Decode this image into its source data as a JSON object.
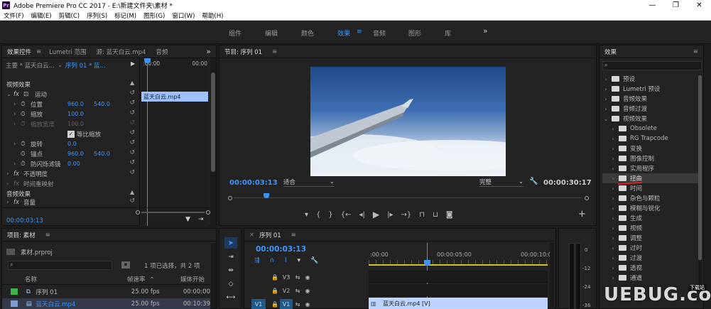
{
  "window": {
    "title": "Adobe Premiere Pro CC 2017 - E:\\新建文件夹\\素材 *",
    "logo": "Pr",
    "controls": [
      "—",
      "❐",
      "✕"
    ]
  },
  "menu": [
    "文件(F)",
    "编辑(E)",
    "剪辑(C)",
    "序列(S)",
    "标记(M)",
    "图形(G)",
    "窗口(W)",
    "帮助(H)"
  ],
  "workspaces": {
    "items": [
      "组件",
      "编辑",
      "颜色",
      "效果",
      "音频",
      "图形",
      "库"
    ],
    "active": "效果",
    "menu_icon": "≡",
    "more": "»"
  },
  "effect_controls": {
    "tabs": [
      "效果控件",
      "Lumetri 范围",
      "源: 蓝天白云.mp4",
      "音频"
    ],
    "tab_menu": "≡",
    "more": "»",
    "master_label": "主要 * 蓝天白云...",
    "sequence_label": "序列 01 * 蓝...",
    "time_start": ":00:00",
    "time_end": "00:00",
    "clip_label": "蓝天白云.mp4",
    "video_effects_label": "视频效果",
    "motion": {
      "fx": "fx",
      "label": "运动",
      "position_label": "位置",
      "position_x": "960.0",
      "position_y": "540.0",
      "scale_label": "缩放",
      "scale_value": "100.0",
      "scale_width_label": "缩放宽度",
      "scale_width_value": "100.0",
      "uniform_label": "等比缩放",
      "rotation_label": "旋转",
      "rotation_value": "0.0",
      "anchor_label": "锚点",
      "anchor_x": "960.0",
      "anchor_y": "540.0",
      "flicker_label": "防闪烁滤镜",
      "flicker_value": "0.00"
    },
    "opacity_label": "不透明度",
    "time_remap_label": "时间重映射",
    "audio_effects_label": "音频效果",
    "volume_label": "音量",
    "current_time": "00:00:03:13"
  },
  "program_monitor": {
    "title": "节目: 序列 01",
    "menu": "≡",
    "timecode": "00:00:03:13",
    "fit_label": "适合",
    "quality_label": "完整",
    "duration": "00:00:30:17"
  },
  "project": {
    "title": "项目: 素材",
    "menu": "≡",
    "file_label": "素材.prproj",
    "selection_info": "1 项已选择，共 2 项",
    "columns": [
      "名称",
      "帧速率",
      "媒体开始"
    ],
    "rows": [
      {
        "name": "序列 01",
        "fps": "25.00 fps",
        "start": "00:00:00",
        "color": "#3cb44b"
      },
      {
        "name": "蓝天白云.mp4",
        "fps": "25.00 fps",
        "start": "00:10:39",
        "color": "#7a9ad8"
      }
    ]
  },
  "timeline": {
    "title": "序列 01",
    "menu": "≡",
    "timecode": "00:00:03:13",
    "ruler": [
      ":00:00",
      "00:00:05:00",
      "00:00:10:0"
    ],
    "tracks": [
      {
        "label": "V3"
      },
      {
        "label": "V2"
      },
      {
        "label": "V1",
        "source": "V1"
      }
    ],
    "clip_label": "蓝天白云.mp4 [V]"
  },
  "meter": {
    "scale": [
      "0",
      "-12",
      "-24",
      "-36"
    ]
  },
  "effects": {
    "title": "效果",
    "menu": "≡",
    "items": [
      {
        "label": "预设",
        "level": 0,
        "open": false
      },
      {
        "label": "Lumetri 预设",
        "level": 0,
        "open": false
      },
      {
        "label": "音频效果",
        "level": 0,
        "open": false
      },
      {
        "label": "音频过渡",
        "level": 0,
        "open": false
      },
      {
        "label": "视频效果",
        "level": 0,
        "open": true
      },
      {
        "label": "Obsolete",
        "level": 1,
        "open": false
      },
      {
        "label": "RG Trapcode",
        "level": 1,
        "open": false
      },
      {
        "label": "变换",
        "level": 1,
        "open": false
      },
      {
        "label": "图像控制",
        "level": 1,
        "open": false
      },
      {
        "label": "实用程序",
        "level": 1,
        "open": false
      },
      {
        "label": "扭曲",
        "level": 1,
        "open": false,
        "selected": true
      },
      {
        "label": "时间",
        "level": 1,
        "open": false
      },
      {
        "label": "杂色与颗粒",
        "level": 1,
        "open": false
      },
      {
        "label": "模糊与锐化",
        "level": 1,
        "open": false
      },
      {
        "label": "生成",
        "level": 1,
        "open": false
      },
      {
        "label": "视频",
        "level": 1,
        "open": false
      },
      {
        "label": "调整",
        "level": 1,
        "open": false
      },
      {
        "label": "过时",
        "level": 1,
        "open": false
      },
      {
        "label": "过渡",
        "level": 1,
        "open": false
      },
      {
        "label": "透视",
        "level": 1,
        "open": false
      },
      {
        "label": "通道",
        "level": 1,
        "open": false
      }
    ]
  },
  "watermark": {
    "text": "UEBUG.com",
    "sub": "下载站"
  },
  "colors": {
    "accent": "#3b95ff",
    "annotation": "#e02020",
    "clip": "#9ec1ff"
  }
}
